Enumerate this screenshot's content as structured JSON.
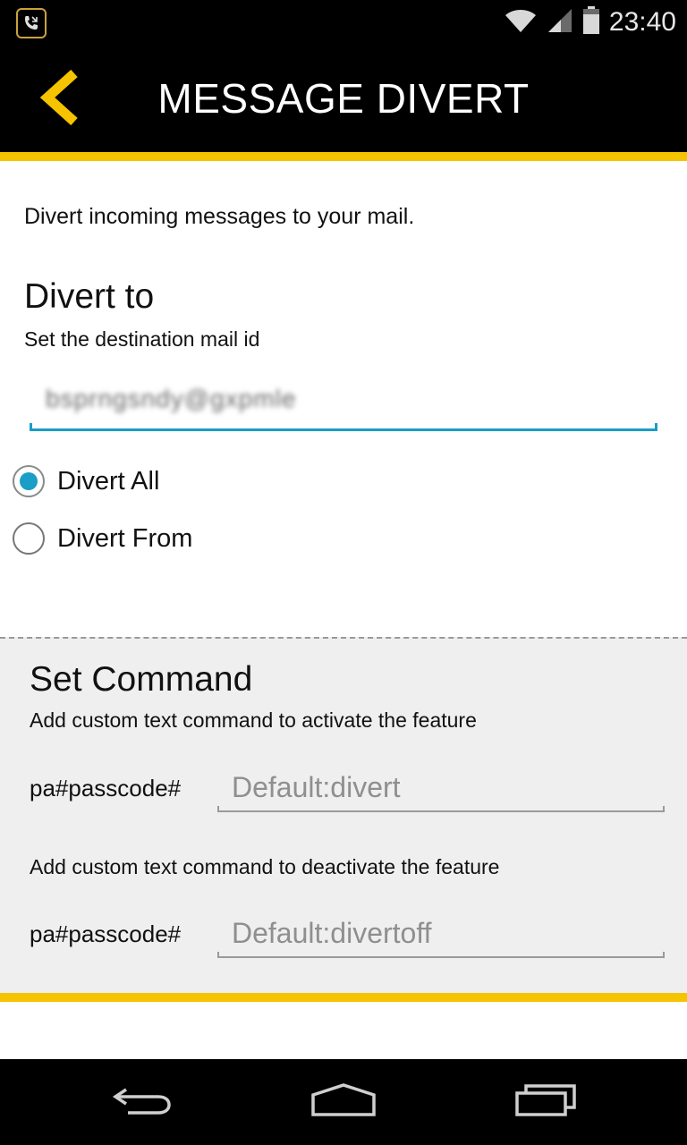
{
  "status_bar": {
    "time": "23:40",
    "icons": [
      "phone-app-icon",
      "wifi-icon",
      "signal-icon",
      "battery-icon"
    ]
  },
  "action_bar": {
    "title": "MESSAGE DIVERT",
    "back_icon": "chevron-left-icon"
  },
  "colors": {
    "accent_yellow": "#f6c300",
    "accent_blue": "#1a9dc7",
    "bar_black": "#000000",
    "section_gray": "#efefef"
  },
  "main": {
    "intro": "Divert incoming messages to your mail.",
    "divert_to": {
      "heading": "Divert to",
      "subheading": "Set the destination mail id",
      "mail_value": "bsprngsndy@gxpmle"
    },
    "radio_options": [
      {
        "label": "Divert All",
        "checked": true
      },
      {
        "label": "Divert From",
        "checked": false
      }
    ]
  },
  "command": {
    "heading": "Set Command",
    "activate_desc": "Add custom text command to activate the feature",
    "activate_prefix": "pa#passcode#",
    "activate_placeholder": "Default:divert",
    "deactivate_desc": "Add custom text command to deactivate the feature",
    "deactivate_prefix": "pa#passcode#",
    "deactivate_placeholder": "Default:divertoff"
  },
  "nav_bar": {
    "buttons": [
      "back-icon",
      "home-icon",
      "recent-apps-icon"
    ]
  }
}
